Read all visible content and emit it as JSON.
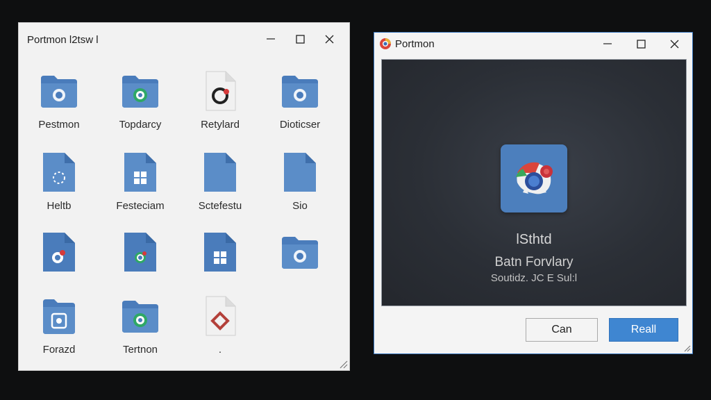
{
  "explorer": {
    "title": "Portmon l2tsw l",
    "items": [
      {
        "label": "Pestmon",
        "icon": "folder-app-icon"
      },
      {
        "label": "Topdarcy",
        "icon": "folder-app-icon"
      },
      {
        "label": "Retylard",
        "icon": "document-app-icon"
      },
      {
        "label": "Dioticser",
        "icon": "folder-app-icon"
      },
      {
        "label": "Heltb",
        "icon": "document-app-icon"
      },
      {
        "label": "Festeciam",
        "icon": "document-grid-icon"
      },
      {
        "label": "Sctefestu",
        "icon": "document-icon"
      },
      {
        "label": "Sio",
        "icon": "document-icon"
      },
      {
        "label": "",
        "icon": "document-app-icon"
      },
      {
        "label": "",
        "icon": "document-app-icon"
      },
      {
        "label": "",
        "icon": "document-grid-icon"
      },
      {
        "label": "",
        "icon": "folder-app-icon"
      },
      {
        "label": "Forazd",
        "icon": "folder-app-icon"
      },
      {
        "label": "Tertnon",
        "icon": "folder-app-icon"
      },
      {
        "label": ".",
        "icon": "document-diamond-icon"
      }
    ]
  },
  "dialog": {
    "title": "Portmon",
    "heading": "lSthtd",
    "subtitle": "Batn Forvlary",
    "subtitle2": "Soutidz. JC E Sul:l",
    "cancel_label": "Can",
    "primary_label": "Reall"
  },
  "colors": {
    "accent": "#3f86d1",
    "folder": "#5b8cc7",
    "panel": "#2b2f36"
  }
}
